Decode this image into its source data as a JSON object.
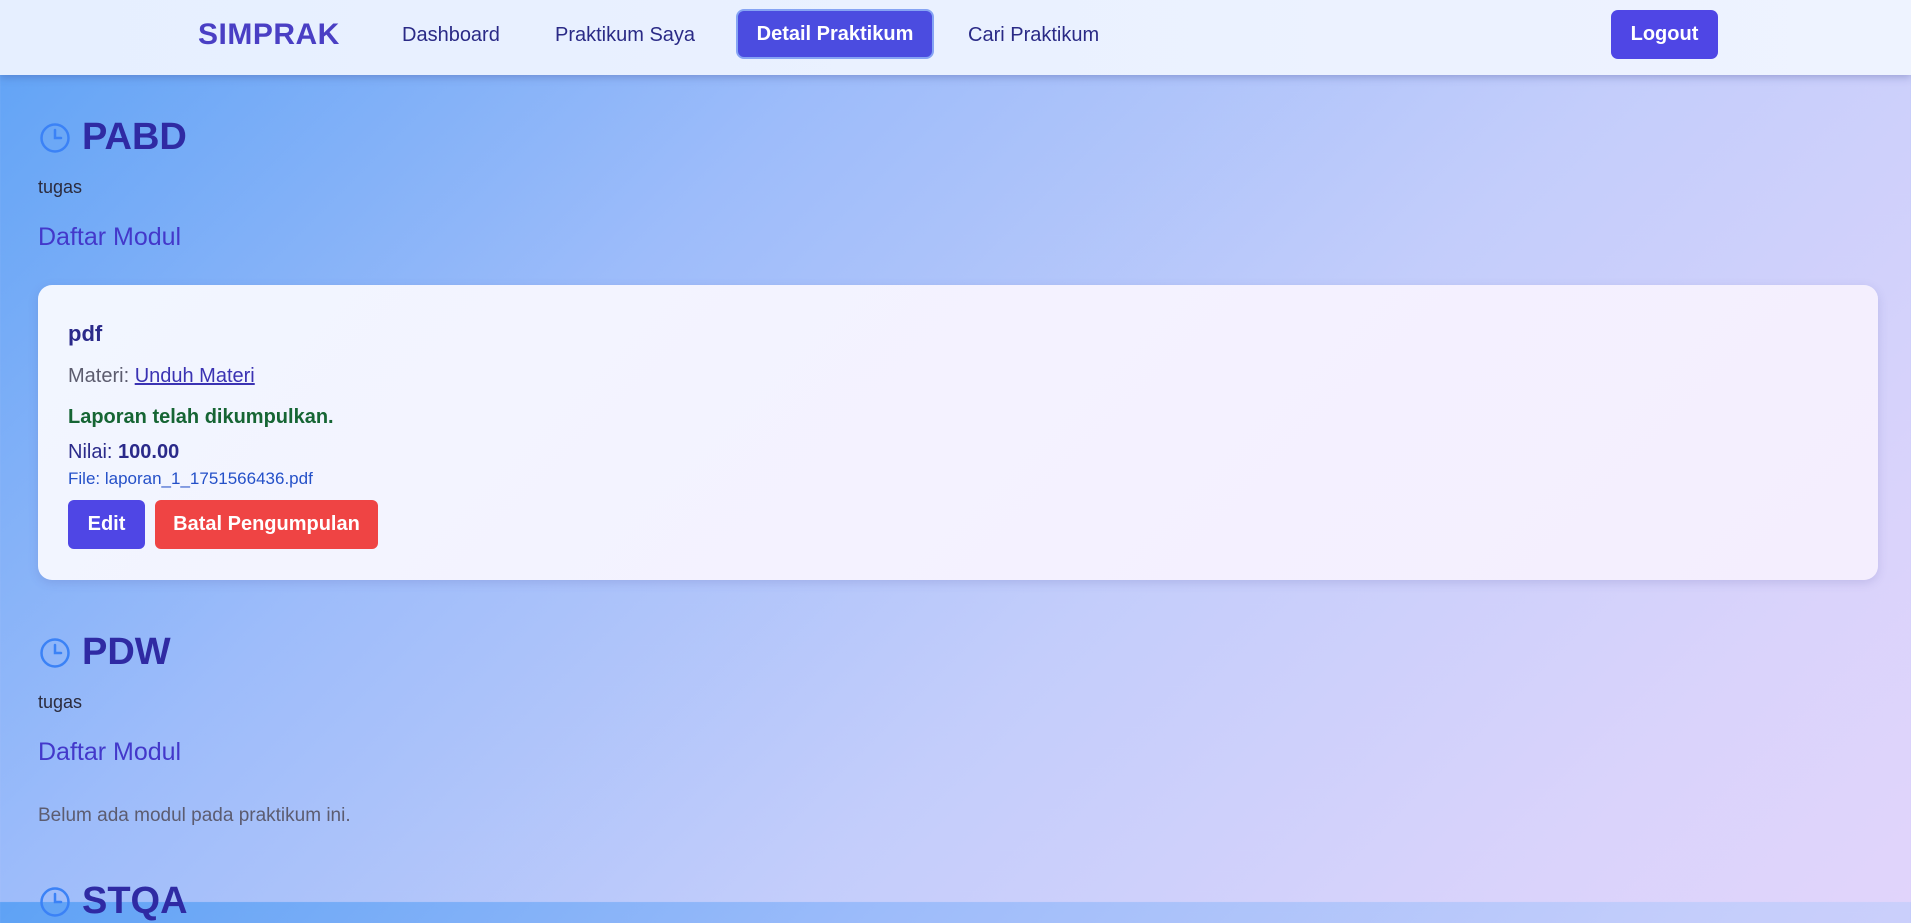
{
  "nav": {
    "brand": "SIMPRAK",
    "links": [
      "Dashboard",
      "Praktikum Saya",
      "Detail Praktikum",
      "Cari Praktikum"
    ],
    "logout": "Logout"
  },
  "sections": [
    {
      "title": "PABD",
      "description": "tugas",
      "subtitle": "Daftar Modul",
      "module": {
        "title": "pdf",
        "materi_label": "Materi:",
        "materi_link": "Unduh Materi",
        "status": "Laporan telah dikumpulkan.",
        "nilai_label": "Nilai:",
        "nilai_value": "100.00",
        "file": "File: laporan_1_1751566436.pdf",
        "edit_label": "Edit",
        "batal_label": "Batal Pengumpulan"
      }
    },
    {
      "title": "PDW",
      "description": "tugas",
      "subtitle": "Daftar Modul",
      "empty_text": "Belum ada modul pada praktikum ini."
    },
    {
      "title": "STQA"
    }
  ],
  "colors": {
    "accent": "#4f46e5",
    "danger": "#ef4444",
    "success": "#166534",
    "clock": "#3b82f6"
  },
  "icons": {
    "section": "clock-icon"
  }
}
